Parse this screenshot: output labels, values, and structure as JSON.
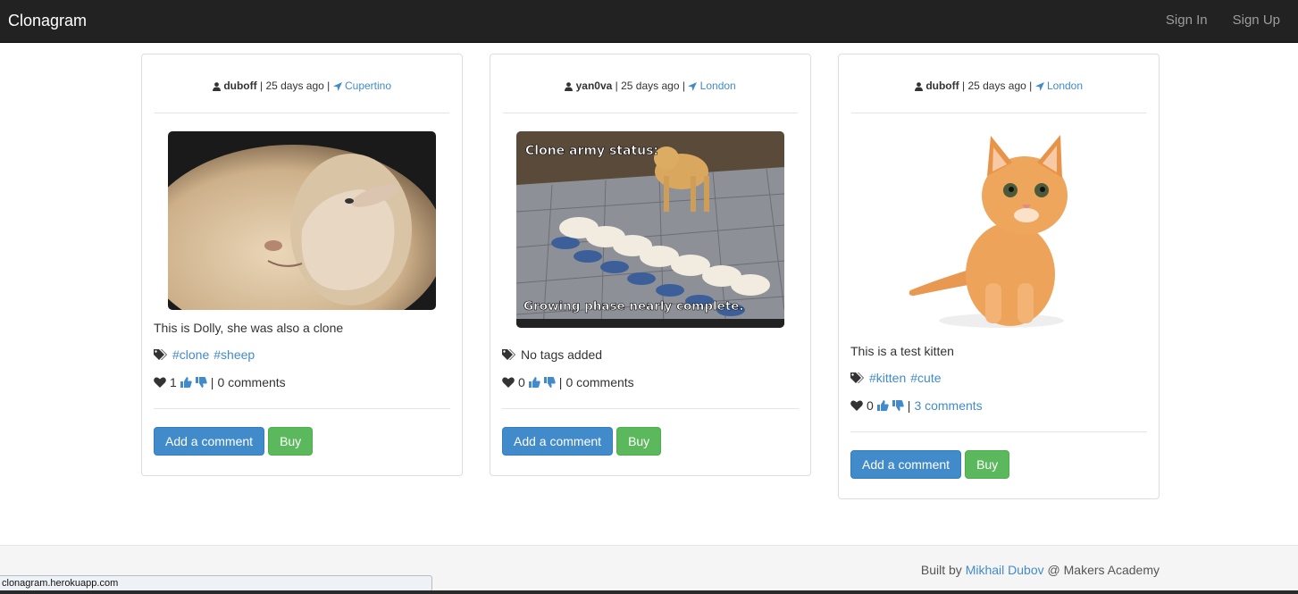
{
  "navbar": {
    "brand": "Clonagram",
    "sign_in": "Sign In",
    "sign_up": "Sign Up"
  },
  "posts": [
    {
      "user": "duboff",
      "time": "25 days ago",
      "location": "Cupertino",
      "caption": "This is Dolly, she was also a clone",
      "tags": [
        "#clone",
        "#sheep"
      ],
      "tags_text": "",
      "likes": "1",
      "comments": "0 comments",
      "add_comment": "Add a comment",
      "buy": "Buy"
    },
    {
      "user": "yan0va",
      "time": "25 days ago",
      "location": "London",
      "caption": "",
      "tags": [],
      "tags_text": "No tags added",
      "likes": "0",
      "comments": "0 comments",
      "add_comment": "Add a comment",
      "buy": "Buy",
      "image_text_top": "Clone army status:",
      "image_text_bottom": "Growing phase nearly complete."
    },
    {
      "user": "duboff",
      "time": "25 days ago",
      "location": "London",
      "caption": "This is a test kitten",
      "tags": [
        "#kitten",
        "#cute"
      ],
      "tags_text": "",
      "likes": "0",
      "comments": "3 comments",
      "add_comment": "Add a comment",
      "buy": "Buy"
    }
  ],
  "footer": {
    "prefix": "Built by ",
    "author": "Mikhail Dubov",
    "suffix": " @ Makers Academy"
  },
  "status_url": "clonagram.herokuapp.com",
  "colors": {
    "link": "#428bca",
    "primary": "#428bca",
    "success": "#5cb85c",
    "navbar": "#222222"
  }
}
